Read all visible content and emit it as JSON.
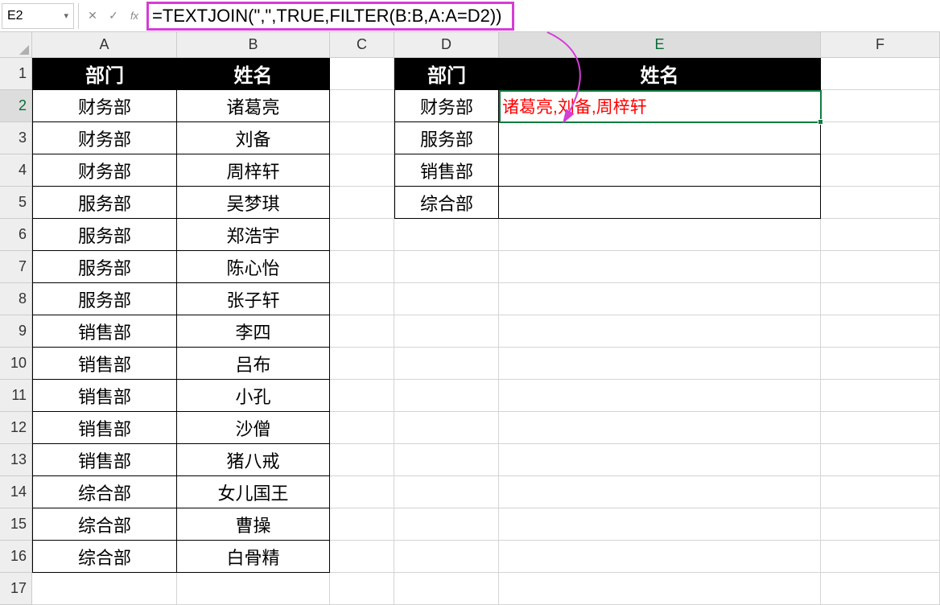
{
  "nameBox": "E2",
  "formula": "=TEXTJOIN(\",\",TRUE,FILTER(B:B,A:A=D2))",
  "columns": [
    "A",
    "B",
    "C",
    "D",
    "E",
    "F"
  ],
  "rows": [
    "1",
    "2",
    "3",
    "4",
    "5",
    "6",
    "7",
    "8",
    "9",
    "10",
    "11",
    "12",
    "13",
    "14",
    "15",
    "16",
    "17"
  ],
  "table1": {
    "headers": {
      "dept": "部门",
      "name": "姓名"
    },
    "rows": [
      {
        "dept": "财务部",
        "name": "诸葛亮"
      },
      {
        "dept": "财务部",
        "name": "刘备"
      },
      {
        "dept": "财务部",
        "name": "周梓轩"
      },
      {
        "dept": "服务部",
        "name": "吴梦琪"
      },
      {
        "dept": "服务部",
        "name": "郑浩宇"
      },
      {
        "dept": "服务部",
        "name": "陈心怡"
      },
      {
        "dept": "服务部",
        "name": "张子轩"
      },
      {
        "dept": "销售部",
        "name": "李四"
      },
      {
        "dept": "销售部",
        "name": "吕布"
      },
      {
        "dept": "销售部",
        "name": "小孔"
      },
      {
        "dept": "销售部",
        "name": "沙僧"
      },
      {
        "dept": "销售部",
        "name": "猪八戒"
      },
      {
        "dept": "综合部",
        "name": "女儿国王"
      },
      {
        "dept": "综合部",
        "name": "曹操"
      },
      {
        "dept": "综合部",
        "name": "白骨精"
      }
    ]
  },
  "table2": {
    "headers": {
      "dept": "部门",
      "name": "姓名"
    },
    "rows": [
      {
        "dept": "财务部",
        "result": "诸葛亮,刘备,周梓轩"
      },
      {
        "dept": "服务部",
        "result": ""
      },
      {
        "dept": "销售部",
        "result": ""
      },
      {
        "dept": "综合部",
        "result": ""
      }
    ]
  },
  "icons": {
    "cancel": "✕",
    "confirm": "✓",
    "fx": "fx",
    "dropdown": "▾"
  }
}
